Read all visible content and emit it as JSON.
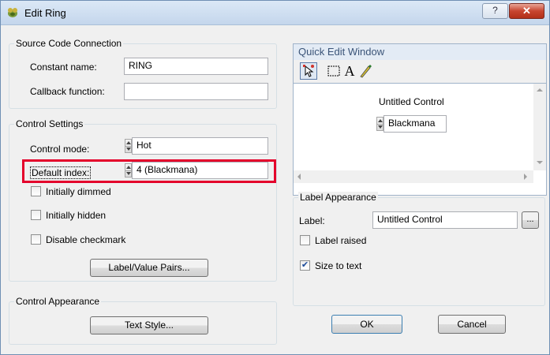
{
  "window": {
    "title": "Edit Ring",
    "help_button": "?",
    "close_button": "✕"
  },
  "source_code_connection": {
    "legend": "Source Code Connection",
    "constant_name_label": "Constant name:",
    "constant_name_value": "RING",
    "callback_label": "Callback function:",
    "callback_value": ""
  },
  "control_settings": {
    "legend": "Control Settings",
    "control_mode_label": "Control mode:",
    "control_mode_value": "Hot",
    "default_index_label": "Default index:",
    "default_index_value": "4 (Blackmana)",
    "initially_dimmed_label": "Initially dimmed",
    "initially_dimmed_checked": false,
    "initially_hidden_label": "Initially hidden",
    "initially_hidden_checked": false,
    "disable_checkmark_label": "Disable checkmark",
    "disable_checkmark_checked": false,
    "label_value_pairs_button": "Label/Value Pairs..."
  },
  "control_appearance": {
    "legend": "Control Appearance",
    "text_style_button": "Text Style..."
  },
  "quick_edit": {
    "title": "Quick Edit Window",
    "tools": [
      "operate-tool-icon",
      "select-tool-icon",
      "text-tool-icon",
      "color-tool-icon"
    ],
    "text_tool_glyph": "A",
    "control_label": "Untitled Control",
    "control_value": "Blackmana"
  },
  "label_appearance": {
    "legend": "Label Appearance",
    "label_label": "Label:",
    "label_value": "Untitled Control",
    "browse_button": "...",
    "label_raised_label": "Label raised",
    "label_raised_checked": false,
    "size_to_text_label": "Size to text",
    "size_to_text_checked": true
  },
  "footer": {
    "ok_button": "OK",
    "cancel_button": "Cancel"
  },
  "colors": {
    "highlight": "#e4002b",
    "title_bar": "#c4d6ec",
    "close_button": "#c7452f"
  }
}
